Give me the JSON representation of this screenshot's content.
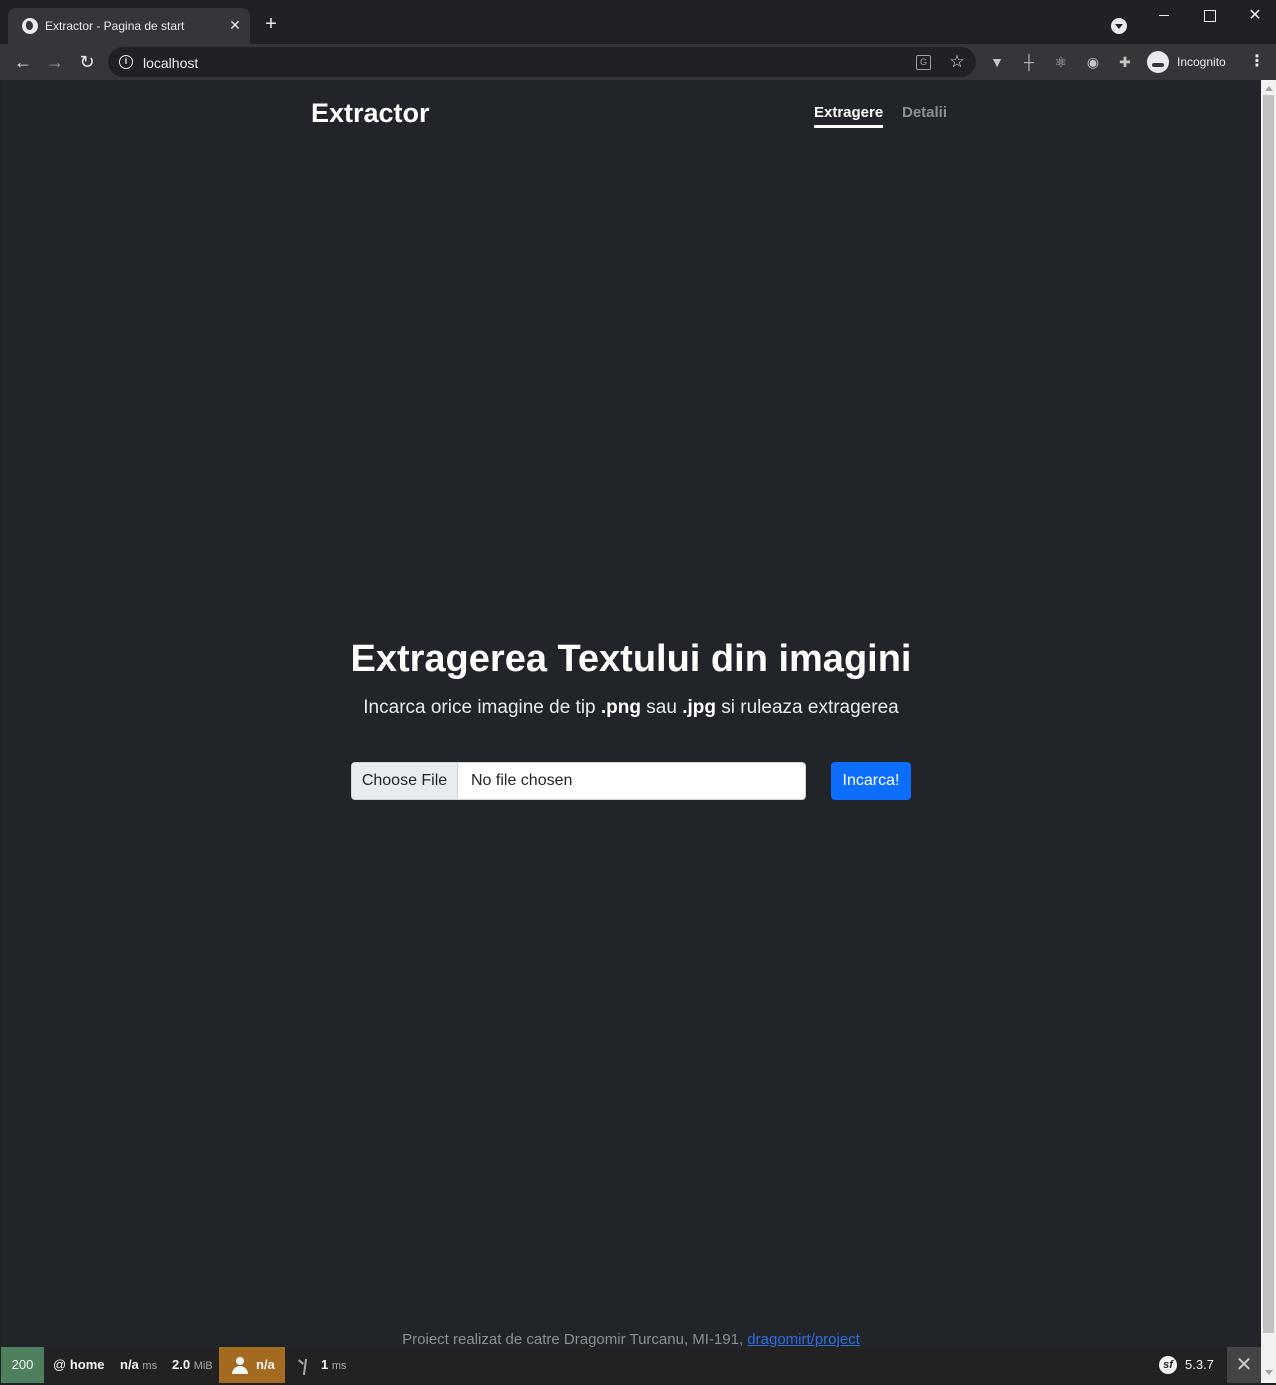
{
  "browser": {
    "tab_title": "Extractor - Pagina de start",
    "tab_close": "✕",
    "new_tab": "+",
    "win_close": "✕",
    "url": "localhost",
    "incognito_label": "Incognito",
    "menu": "⋮",
    "back": "←",
    "forward": "→",
    "reload": "↻",
    "star": "☆",
    "translate": "G"
  },
  "header": {
    "brand": "Extractor",
    "nav": [
      {
        "label": "Extragere"
      },
      {
        "label": "Detalii"
      }
    ]
  },
  "hero": {
    "title": "Extragerea Textului din imagini",
    "subtitle_pre": "Incarca orice imagine de tip ",
    "subtitle_ext1": ".png",
    "subtitle_mid": " sau ",
    "subtitle_ext2": ".jpg",
    "subtitle_post": " si ruleaza extragerea"
  },
  "upload": {
    "choose_label": "Choose File",
    "status": "No file chosen",
    "submit_label": "Incarca!"
  },
  "footer": {
    "text": "Proiect realizat de catre Dragomir Turcanu, MI-191, ",
    "link_text": "dragomirt/project"
  },
  "debug_toolbar": {
    "status_code": "200",
    "route_prefix": "@",
    "route": "home",
    "time_value": "n/a",
    "time_unit": "ms",
    "memory_value": "2.0",
    "memory_unit": "MiB",
    "user": "n/a",
    "twig_value": "1",
    "twig_unit": "ms",
    "version": "5.3.7",
    "version_icon": "sf",
    "close": "✕"
  }
}
